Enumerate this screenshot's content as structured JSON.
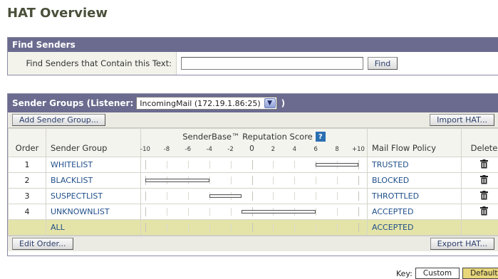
{
  "page": {
    "title": "HAT Overview"
  },
  "find": {
    "header": "Find Senders",
    "label": "Find Senders that Contain this Text:",
    "value": "",
    "button": "Find"
  },
  "groups": {
    "header": "Sender Groups (Listener:",
    "listener": "IncomingMail (172.19.1.86:25)",
    "close_paren": ")",
    "add_button": "Add Sender Group...",
    "import_button": "Import HAT...",
    "edit_button": "Edit Order...",
    "export_button": "Export HAT...",
    "columns": {
      "order": "Order",
      "group": "Sender Group",
      "score": "SenderBase™ Reputation Score",
      "policy": "Mail Flow Policy",
      "delete": "Delete"
    },
    "score_ticks": [
      "-10",
      "-8",
      "-6",
      "-4",
      "-2",
      "0",
      "2",
      "4",
      "6",
      "8",
      "+10"
    ],
    "rows": [
      {
        "order": "1",
        "name": "WHITELIST",
        "policy": "TRUSTED",
        "range": [
          6,
          10
        ],
        "deletable": true
      },
      {
        "order": "2",
        "name": "BLACKLIST",
        "policy": "BLOCKED",
        "range": [
          -10,
          -4
        ],
        "deletable": true
      },
      {
        "order": "3",
        "name": "SUSPECTLIST",
        "policy": "THROTTLED",
        "range": [
          -4,
          -1
        ],
        "deletable": true
      },
      {
        "order": "4",
        "name": "UNKNOWNLIST",
        "policy": "ACCEPTED",
        "range": [
          -1,
          6
        ],
        "deletable": true
      },
      {
        "order": "",
        "name": "ALL",
        "policy": "ACCEPTED",
        "range": null,
        "deletable": false
      }
    ]
  },
  "key": {
    "label": "Key:",
    "custom": "Custom",
    "default": "Default"
  },
  "colors": {
    "panel_header": "#6b6b8f",
    "all_row": "#e5e4a8",
    "default_key": "#e8d67a",
    "link": "#1f4f8a"
  },
  "icons": {
    "help": "help-icon",
    "delete": "trash-icon",
    "dropdown": "chevron-down-icon"
  }
}
